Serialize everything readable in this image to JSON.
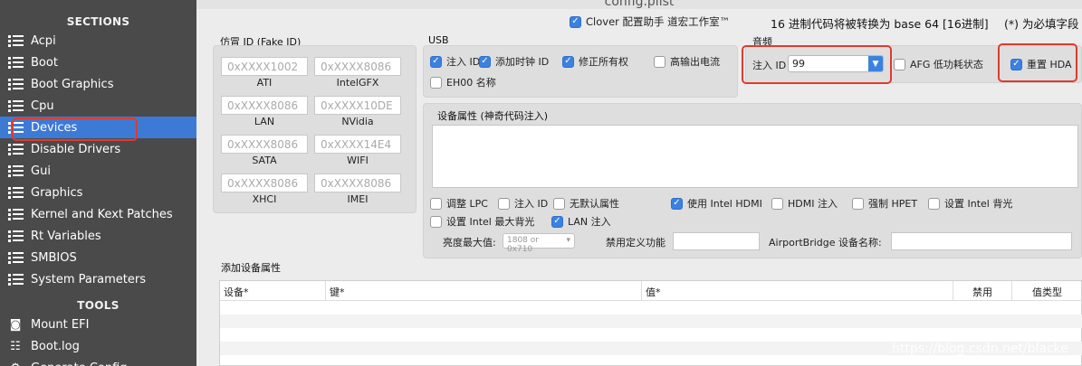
{
  "window": {
    "title": "config.plist"
  },
  "sidebar": {
    "sections_heading": "SECTIONS",
    "items": [
      {
        "label": "Acpi",
        "icon": "list-icon"
      },
      {
        "label": "Boot",
        "icon": "list-icon"
      },
      {
        "label": "Boot Graphics",
        "icon": "list-icon"
      },
      {
        "label": "Cpu",
        "icon": "list-icon"
      },
      {
        "label": "Devices",
        "icon": "list-icon",
        "selected": true
      },
      {
        "label": "Disable Drivers",
        "icon": "list-icon"
      },
      {
        "label": "Gui",
        "icon": "list-icon"
      },
      {
        "label": "Graphics",
        "icon": "list-icon"
      },
      {
        "label": "Kernel and Kext Patches",
        "icon": "list-icon"
      },
      {
        "label": "Rt Variables",
        "icon": "list-icon"
      },
      {
        "label": "SMBIOS",
        "icon": "list-icon"
      },
      {
        "label": "System Parameters",
        "icon": "list-icon"
      }
    ],
    "tools_heading": "TOOLS",
    "tools": [
      {
        "label": "Mount EFI",
        "icon": "disk-icon"
      },
      {
        "label": "Boot.log",
        "icon": "log-icon"
      },
      {
        "label": "Generate Config",
        "icon": "gear-icon"
      }
    ]
  },
  "top_bar": {
    "clover_checkbox": {
      "label": "Clover 配置助手 道宏工作室™",
      "checked": true
    },
    "hex_notice": "16 进制代码将被转换为 base 64 [16进制]",
    "required_notice": "(*) 为必填字段"
  },
  "fake_id": {
    "heading": "仿冒 ID (Fake ID)",
    "fields": [
      {
        "placeholder": "0xXXXX1002",
        "label": "ATI"
      },
      {
        "placeholder": "0xXXXX8086",
        "label": "IntelGFX"
      },
      {
        "placeholder": "0xXXXX8086",
        "label": "LAN"
      },
      {
        "placeholder": "0xXXXX10DE",
        "label": "NVidia"
      },
      {
        "placeholder": "0xXXXX8086",
        "label": "SATA"
      },
      {
        "placeholder": "0xXXXX14E4",
        "label": "WIFI"
      },
      {
        "placeholder": "0xXXXX8086",
        "label": "XHCI"
      },
      {
        "placeholder": "0xXXXX8086",
        "label": "IMEI"
      }
    ]
  },
  "usb": {
    "heading": "USB",
    "options": [
      {
        "label": "注入 ID",
        "checked": true
      },
      {
        "label": "添加时钟 ID",
        "checked": true
      },
      {
        "label": "修正所有权",
        "checked": true
      },
      {
        "label": "高输出电流",
        "checked": false
      },
      {
        "label": "EH00 名称",
        "checked": false
      }
    ]
  },
  "audio": {
    "heading": "音频",
    "inject_label": "注入 ID",
    "inject_value": "99",
    "afg_label": "AFG 低功耗状态",
    "afg_checked": false,
    "reset_hda_label": "重置 HDA",
    "reset_hda_checked": true
  },
  "properties": {
    "heading": "设备属性 (神奇代码注入)",
    "options": [
      {
        "label": "调整 LPC",
        "checked": false
      },
      {
        "label": "注入 ID",
        "checked": false
      },
      {
        "label": "无默认属性",
        "checked": false
      },
      {
        "label": "使用 Intel HDMI",
        "checked": true
      },
      {
        "label": "HDMI 注入",
        "checked": false
      },
      {
        "label": "强制 HPET",
        "checked": false
      },
      {
        "label": "设置 Intel 背光",
        "checked": false
      },
      {
        "label": "设置 Intel 最大背光",
        "checked": false
      },
      {
        "label": "LAN 注入",
        "checked": true
      }
    ],
    "brightness_label": "亮度最大值:",
    "brightness_placeholder": "1808 or 0x710",
    "disable_function_label": "禁用定义功能",
    "disable_function_value": "",
    "airport_label": "AirportBridge 设备名称:",
    "airport_value": ""
  },
  "add_properties": {
    "heading": "添加设备属性",
    "columns": [
      "设备*",
      "键*",
      "值*",
      "禁用",
      "值类型"
    ]
  },
  "watermark": "https://blog.csdn.net/blacke"
}
